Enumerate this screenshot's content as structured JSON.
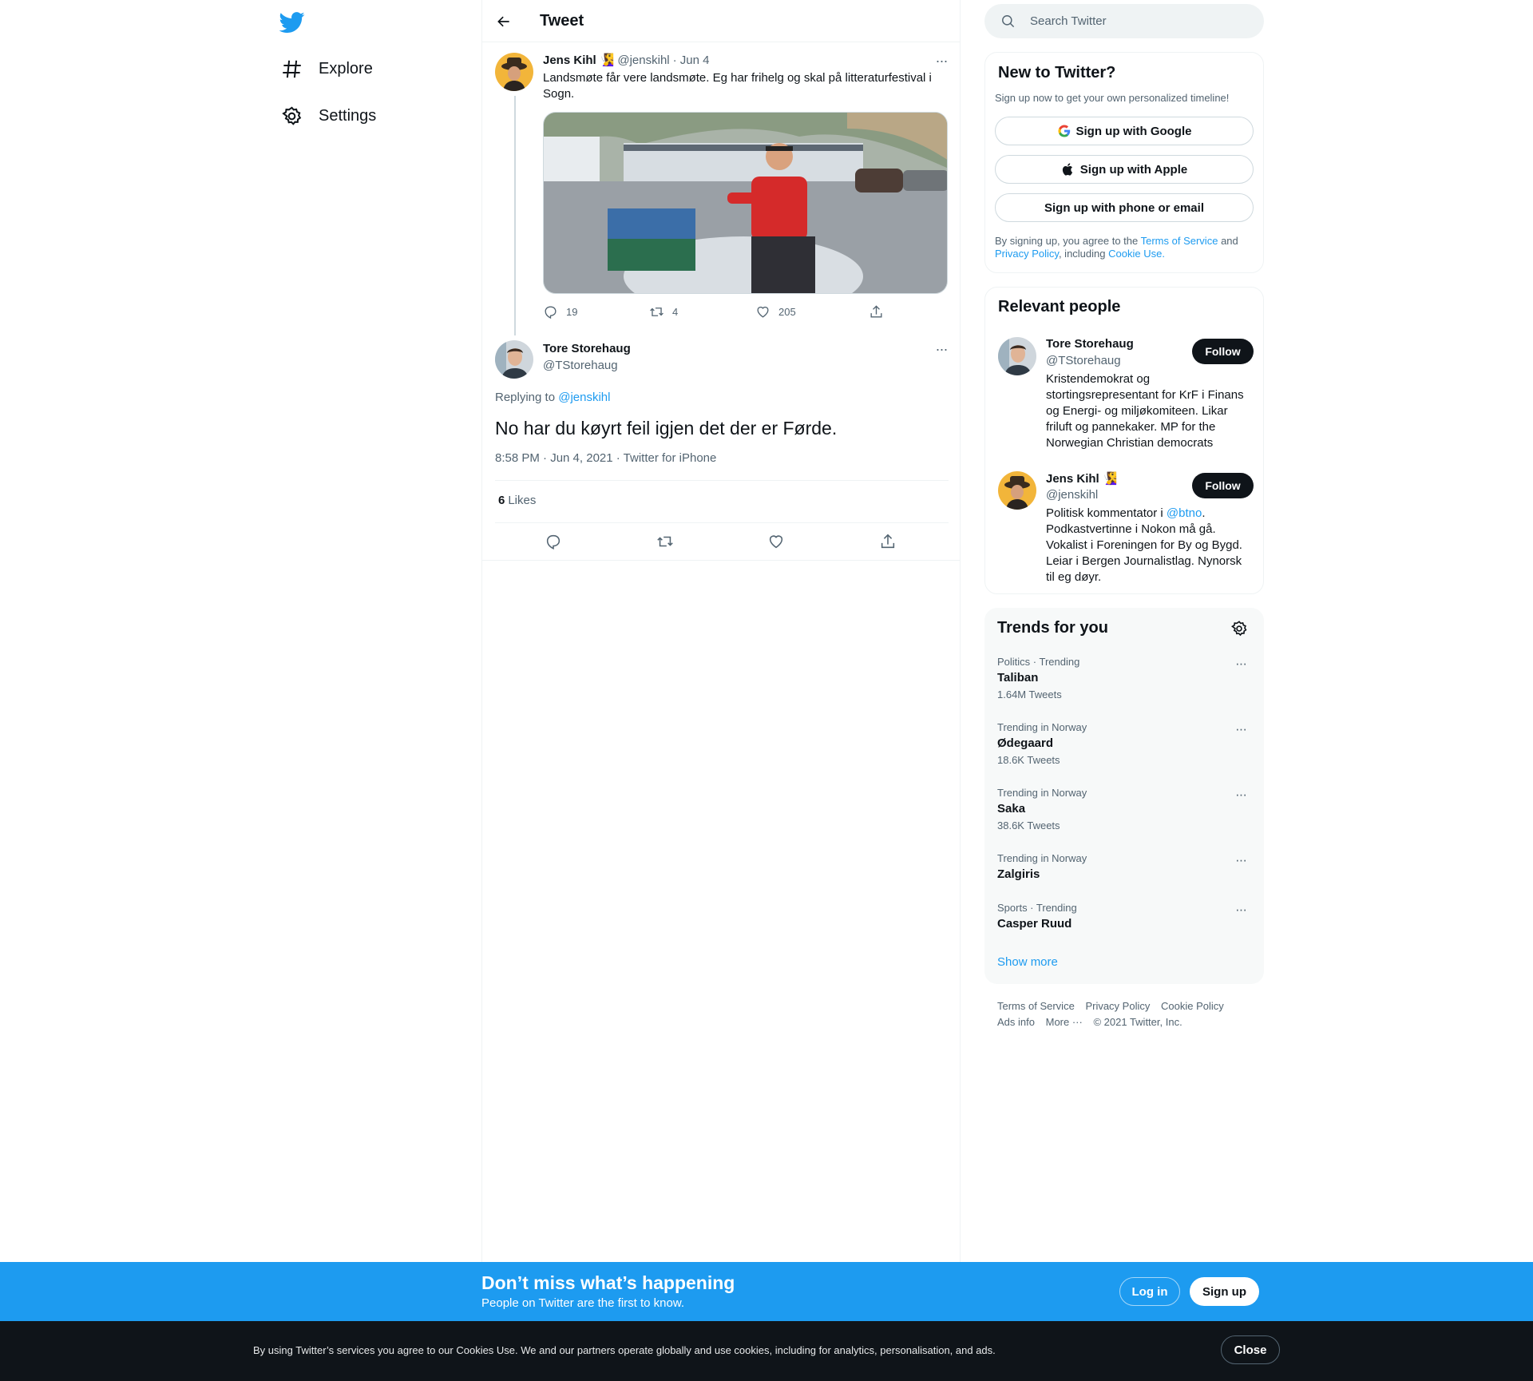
{
  "nav": {
    "items": [
      {
        "label": "Explore",
        "icon": "hashtag-icon"
      },
      {
        "label": "Settings",
        "icon": "gear-icon"
      }
    ]
  },
  "header": {
    "title": "Tweet"
  },
  "parent_tweet": {
    "author_name": "Jens Kihl",
    "author_emoji": "🧏‍♀️",
    "handle": "@jenskihl",
    "date": "· Jun 4",
    "text": "Landsmøte får vere landsmøte. Eg har frihelg og skal på litteraturfestival i Sogn.",
    "replies": "19",
    "retweets": "4",
    "likes": "205"
  },
  "main_tweet": {
    "author_name": "Tore Storehaug",
    "handle": "@TStorehaug",
    "replying_prefix": "Replying to",
    "replying_to": "@jenskihl",
    "text": "No har du køyrt feil igjen det der er Førde.",
    "meta": "8:58 PM · Jun 4, 2021 · Twitter for iPhone",
    "likes_count": "6",
    "likes_label": "Likes"
  },
  "search": {
    "placeholder": "Search Twitter"
  },
  "new_to_twitter": {
    "title": "New to Twitter?",
    "subtitle": "Sign up now to get your own personalized timeline!",
    "google": "Sign up with Google",
    "apple": "Sign up with Apple",
    "phone": "Sign up with phone or email",
    "legal_1": "By signing up, you agree to the",
    "terms": "Terms of Service",
    "and": "and",
    "privacy": "Privacy Policy",
    "including": ", including",
    "cookie": "Cookie Use."
  },
  "relevant_people": {
    "title": "Relevant people",
    "people": [
      {
        "name": "Tore Storehaug",
        "handle": "@TStorehaug",
        "bio": "Kristendemokrat og stortingsrepresentant for KrF i Finans og Energi- og miljøkomiteen. Likar friluft og pannekaker. MP for the Norwegian Christian democrats",
        "follow": "Follow"
      },
      {
        "name": "Jens Kihl",
        "emoji": "🧏‍♀️",
        "handle": "@jenskihl",
        "bio_pre": "Politisk kommentator i",
        "bio_link": "@btno",
        "bio_post": ". Podkastvertinne i Nokon må gå. Vokalist i Foreningen for By og Bygd. Leiar i Bergen Journalistlag. Nynorsk til eg døyr.",
        "follow": "Follow"
      }
    ]
  },
  "trends": {
    "title": "Trends for you",
    "items": [
      {
        "context": "Politics · Trending",
        "name": "Taliban",
        "count": "1.64M Tweets"
      },
      {
        "context": "Trending in Norway",
        "name": "Ødegaard",
        "count": "18.6K Tweets"
      },
      {
        "context": "Trending in Norway",
        "name": "Saka",
        "count": "38.6K Tweets"
      },
      {
        "context": "Trending in Norway",
        "name": "Zalgiris",
        "count": ""
      },
      {
        "context": "Sports · Trending",
        "name": "Casper Ruud",
        "count": ""
      }
    ],
    "show_more": "Show more"
  },
  "footer": {
    "links": [
      "Terms of Service",
      "Privacy Policy",
      "Cookie Policy",
      "Ads info",
      "More ···",
      "© 2021 Twitter, Inc."
    ]
  },
  "signup_bar": {
    "title": "Don’t miss what’s happening",
    "subtitle": "People on Twitter are the first to know.",
    "login": "Log in",
    "signup": "Sign up"
  },
  "cookie_bar": {
    "text": "By using Twitter’s services you agree to our Cookies Use. We and our partners operate globally and use cookies, including for analytics, personalisation, and ads.",
    "close": "Close"
  },
  "colors": {
    "accent": "#1d9bf0",
    "text": "#0f1419",
    "muted": "#536471",
    "border": "#eff3f4"
  }
}
